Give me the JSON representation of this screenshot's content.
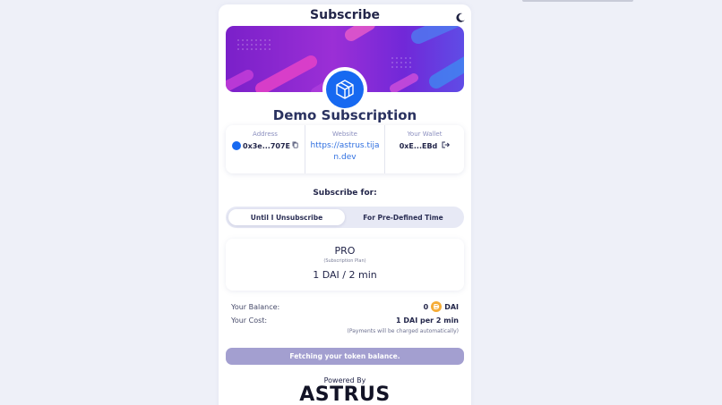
{
  "header": {
    "title": "Subscribe",
    "theme_icon": "moon-icon"
  },
  "subscription": {
    "name": "Demo Subscription"
  },
  "info": {
    "address_label": "Address",
    "address_value": "0x3e...707E",
    "website_label": "Website",
    "website_value": "https://astrus.tijan.dev",
    "wallet_label": "Your Wallet",
    "wallet_value": "0xE...EBd"
  },
  "subscribe_for": {
    "title": "Subscribe for:",
    "tabs": [
      {
        "label": "Until I Unsubscribe",
        "active": true
      },
      {
        "label": "For Pre-Defined Time",
        "active": false
      }
    ]
  },
  "plan": {
    "name": "PRO",
    "subtitle": "(Subscription Plan)",
    "price": "1 DAI / 2 min"
  },
  "balance": {
    "label": "Your Balance:",
    "value": "0",
    "token": "DAI"
  },
  "cost": {
    "label": "Your Cost:",
    "value": "1 DAI per 2 min",
    "note": "(Payments will be charged automatically)"
  },
  "action": {
    "label": "Fetching your token balance."
  },
  "footer": {
    "powered_by": "Powered By",
    "brand": "ASTRUS"
  },
  "colors": {
    "accent": "#1769f1",
    "button": "#a39fd0",
    "banner": "#8a2bd6",
    "dai": "#f5ac37"
  }
}
